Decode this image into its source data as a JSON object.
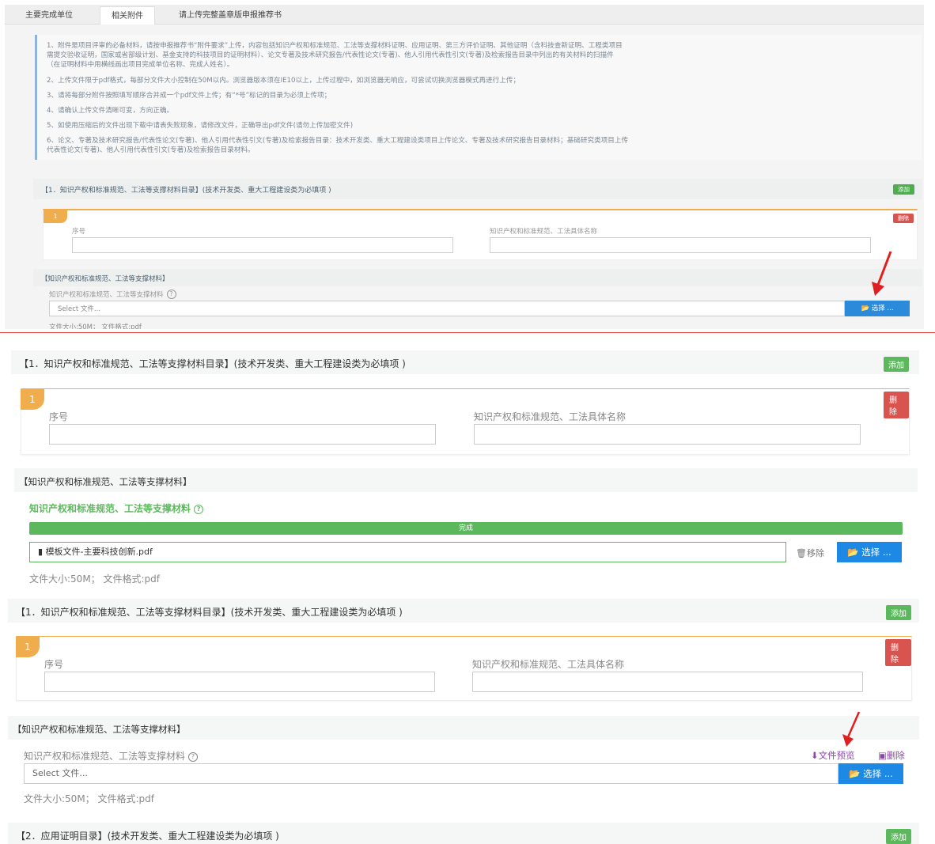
{
  "tabs": [
    "主要完成单位",
    "相关附件",
    "请上传完整盖章版申报推荐书"
  ],
  "notice_lines": [
    "1、附件是项目评审的必备材料，请按申报推荐书“附件要求”上传，内容包括知识产权和标准规范、工法等支撑材料证明、应用证明、第三方评价证明、其他证明（含科技查新证明、工程类项目",
    "需提交验收证明，国家或省部级计划、基金支持的科技项目的证明材料）、论文专著及技术研究报告/代表性论文(专著)、他人引用代表性引文(专著)及检索报告目录中列出的有关材料的扫描件",
    "（在证明材料中用横线画出项目完成单位名称、完成人姓名）。",
    "2、上传文件限于pdf格式，每部分文件大小控制在50M以内。浏览器版本须在IE10以上，上传过程中，如浏览器无响应，可尝试切换浏览器模式再进行上传；",
    "3、请将每部分附件按照填写顺序合并成一个pdf文件上传；有“*号”标记的目录为必须上传项；",
    "4、请确认上传文件清晰可变，方向正确。",
    "5、如使用压缩后的文件出现下载中请表失败现象，请修改文件，正确导出pdf文件(请勿上传加密文件)",
    "6、论文、专著及技术研究报告/代表性论文(专著)、他人引用代表性引文(专著)及检索报告目录：技术开发类、重大工程建设类项目上传论文、专著及技术研究报告目录材料；基础研究类项目上传",
    "代表性论文(专著)、他人引用代表性引文(专著)及检索报告目录材料。"
  ],
  "section1_title": "【1．知识产权和标准规范、工法等支撑材料目录】(技术开发类、重大工程建设类为必填项 )",
  "section2_title": "【2．应用证明目录】(技术开发类、重大工程建设类为必填项 )",
  "add_label": "添加",
  "delete_label": "删除",
  "item_number": "1",
  "field_seq": "序号",
  "field_name": "知识产权和标准规范、工法具体名称",
  "material_section": "【知识产权和标准规范、工法等支撑材料】",
  "material_label": "知识产权和标准规范、工法等支撑材料",
  "select_placeholder": "Select 文件...",
  "select_button": "选择 ...",
  "file_meta": "文件大小:50M；   文件格式:pdf",
  "progress_text": "完成",
  "progress_percent": 100,
  "uploaded_file": "模板文件-主要科技创新.pdf",
  "remove_label": "移除",
  "preview_label": "文件预览",
  "delete_file_label": "删除",
  "help_glyph": "?",
  "colors": {
    "add": "#5cb85c",
    "delete": "#d9534f",
    "select": "#1e88e5",
    "accent_orange": "#f0ad4e",
    "link": "#8e44ad",
    "arrow": "#e02020"
  },
  "icons": [
    "folder-open-icon",
    "file-icon",
    "trash-icon",
    "download-icon",
    "image-icon",
    "help-icon",
    "red-arrow-icon"
  ]
}
